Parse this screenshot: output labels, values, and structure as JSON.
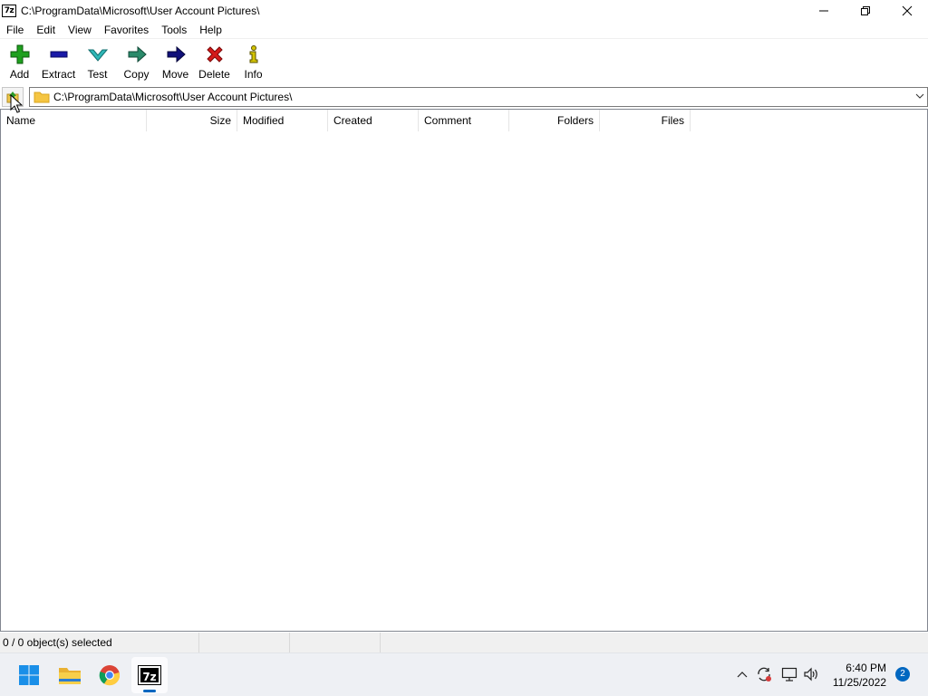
{
  "window": {
    "title": "C:\\ProgramData\\Microsoft\\User Account Pictures\\",
    "app_icon_text": "7z"
  },
  "menu": [
    "File",
    "Edit",
    "View",
    "Favorites",
    "Tools",
    "Help"
  ],
  "toolbar": [
    {
      "label": "Add",
      "icon": "add-icon"
    },
    {
      "label": "Extract",
      "icon": "extract-icon"
    },
    {
      "label": "Test",
      "icon": "test-icon"
    },
    {
      "label": "Copy",
      "icon": "copy-icon"
    },
    {
      "label": "Move",
      "icon": "move-icon"
    },
    {
      "label": "Delete",
      "icon": "delete-icon"
    },
    {
      "label": "Info",
      "icon": "info-icon"
    }
  ],
  "address": {
    "path": "C:\\ProgramData\\Microsoft\\User Account Pictures\\"
  },
  "columns": [
    "Name",
    "Size",
    "Modified",
    "Created",
    "Comment",
    "Folders",
    "Files"
  ],
  "rows": [],
  "status": {
    "selection": "0 / 0 object(s) selected",
    "cell2": "",
    "cell3": "",
    "cell4": ""
  },
  "taskbar": {
    "apps": [
      "start",
      "file-explorer",
      "chrome",
      "7-zip"
    ],
    "active_app": "7z",
    "time": "6:40 PM",
    "date": "11/25/2022",
    "notification_count": "2"
  },
  "colors": {
    "accent": "#0067c0",
    "add": "#1fa01f",
    "extract": "#1a1aa8",
    "test": "#2fb8b8",
    "copy": "#2a8a6a",
    "move": "#10107a",
    "delete": "#d41a1a",
    "info": "#d4c400"
  }
}
